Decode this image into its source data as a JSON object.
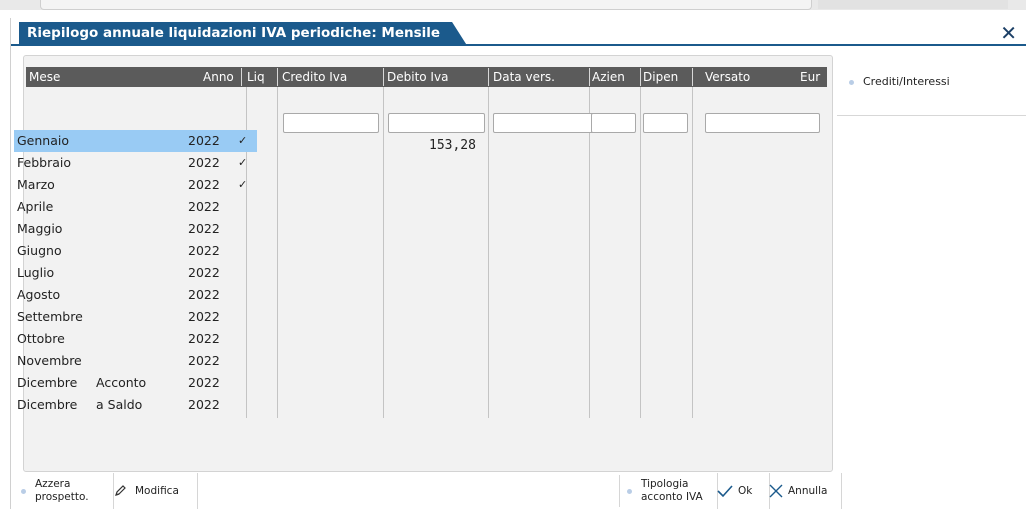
{
  "window": {
    "title": "Riepilogo annuale liquidazioni IVA periodiche: Mensile",
    "close_glyph": "✕"
  },
  "side": {
    "crediti_label": "Crediti/Interessi"
  },
  "columns": {
    "mese": "Mese",
    "anno": "Anno",
    "liq": "Liq",
    "credito": "Credito Iva",
    "debito": "Debito Iva",
    "data": "Data vers.",
    "azien": "Azien",
    "dipen": "Dipen",
    "versato": "Versato",
    "eur": "Eur"
  },
  "rows": [
    {
      "mese": "Gennaio",
      "sub": "",
      "anno": "2022",
      "liq": "✓"
    },
    {
      "mese": "Febbraio",
      "sub": "",
      "anno": "2022",
      "liq": "✓"
    },
    {
      "mese": "Marzo",
      "sub": "",
      "anno": "2022",
      "liq": "✓"
    },
    {
      "mese": "Aprile",
      "sub": "",
      "anno": "2022",
      "liq": ""
    },
    {
      "mese": "Maggio",
      "sub": "",
      "anno": "2022",
      "liq": ""
    },
    {
      "mese": "Giugno",
      "sub": "",
      "anno": "2022",
      "liq": ""
    },
    {
      "mese": "Luglio",
      "sub": "",
      "anno": "2022",
      "liq": ""
    },
    {
      "mese": "Agosto",
      "sub": "",
      "anno": "2022",
      "liq": ""
    },
    {
      "mese": "Settembre",
      "sub": "",
      "anno": "2022",
      "liq": ""
    },
    {
      "mese": "Ottobre",
      "sub": "",
      "anno": "2022",
      "liq": ""
    },
    {
      "mese": "Novembre",
      "sub": "",
      "anno": "2022",
      "liq": ""
    },
    {
      "mese": "Dicembre",
      "sub": "Acconto",
      "anno": "2022",
      "liq": ""
    },
    {
      "mese": "Dicembre",
      "sub": "a Saldo",
      "anno": "2022",
      "liq": ""
    }
  ],
  "debito_febbraio": "153,28",
  "buttons": {
    "azzera_1": "Azzera",
    "azzera_2": "prospetto.",
    "modifica": "Modifica",
    "tipologia_1": "Tipologia",
    "tipologia_2": "acconto IVA",
    "ok": "Ok",
    "annulla": "Annulla"
  }
}
